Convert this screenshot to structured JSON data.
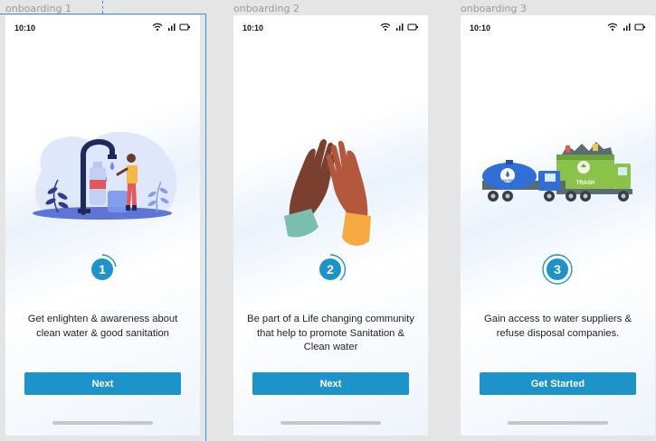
{
  "screens": [
    {
      "frame_label": "onboarding 1",
      "time": "10:10",
      "step_number": "1",
      "caption": "Get enlighten & awareness about clean water & good sanitation",
      "button_label": "Next",
      "illustration": "water-tap-illustration"
    },
    {
      "frame_label": "onboarding 2",
      "time": "10:10",
      "step_number": "2",
      "caption": "Be part of a Life changing community that help to promote Sanitation & Clean water",
      "button_label": "Next",
      "illustration": "high-five-illustration"
    },
    {
      "frame_label": "onboarding 3",
      "time": "10:10",
      "step_number": "3",
      "caption": "Gain access to water suppliers & refuse disposal companies.",
      "button_label": "Get Started",
      "illustration": "trucks-illustration",
      "truck_labels": {
        "water": "WATER",
        "trash": "TRASH"
      }
    }
  ],
  "colors": {
    "accent": "#1e93c9",
    "canvas": "#e5e5e5",
    "selection": "#3d8fd6"
  },
  "icons": [
    "wifi-icon",
    "signal-icon",
    "battery-icon"
  ]
}
